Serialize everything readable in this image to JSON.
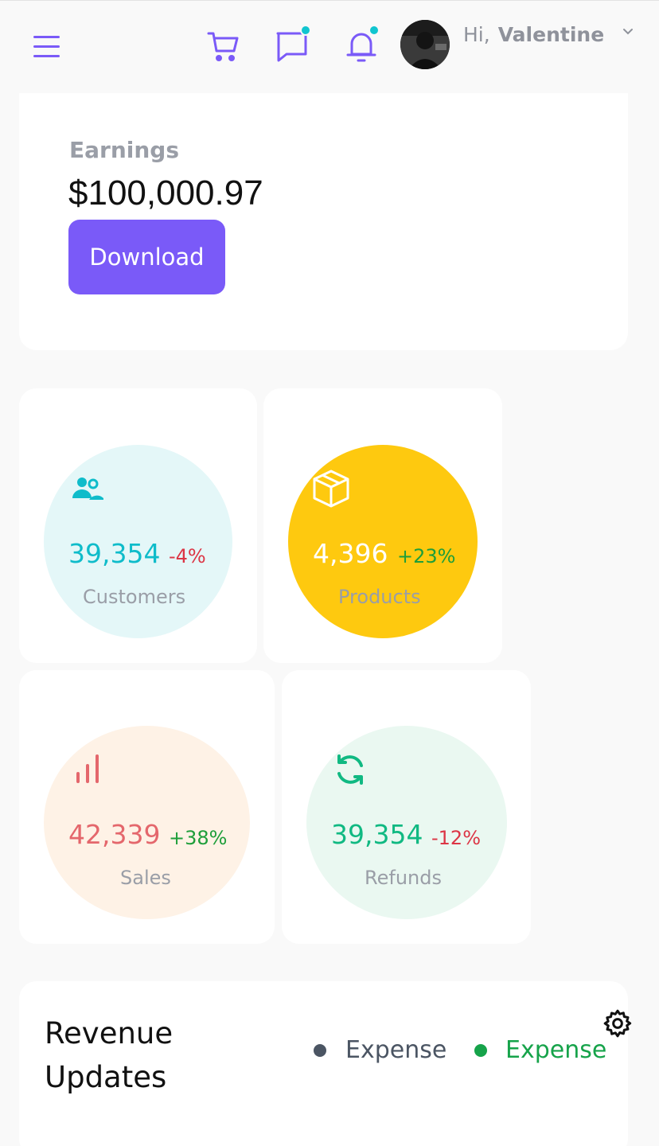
{
  "header": {
    "menu_icon": "hamburger-menu-icon",
    "cart_icon": "cart-icon",
    "messages_icon": "chat-bubble-icon",
    "notifications_icon": "bell-icon",
    "greeting": "Hi,",
    "user_name": "Valentine",
    "dropdown_icon": "chevron-down-icon"
  },
  "earnings": {
    "label": "Earnings",
    "value": "$100,000.97",
    "button_label": "Download"
  },
  "stats": [
    {
      "icon": "users-icon",
      "value": "39,354",
      "change": "-4%",
      "label": "Customers",
      "color": "#0fbcca",
      "bg": "#e4f7f8",
      "change_color": "#dc3545"
    },
    {
      "icon": "box-icon",
      "value": "4,396",
      "change": "+23%",
      "label": "Products",
      "color": "#ffffff",
      "bg": "#fec90f",
      "change_color": "#1e9e3a"
    },
    {
      "icon": "bar-chart-icon",
      "value": "42,339",
      "change": "+38%",
      "label": "Sales",
      "color": "#e4676c",
      "bg": "#fef2e6",
      "change_color": "#1e9e3a"
    },
    {
      "icon": "refresh-icon",
      "value": "39,354",
      "change": "-12%",
      "label": "Refunds",
      "color": "#10b982",
      "bg": "#eaf8f1",
      "change_color": "#dc3545"
    }
  ],
  "revenue": {
    "title": "Revenue Updates",
    "legend": [
      {
        "label": "Expense",
        "color": "#4b5563"
      },
      {
        "label": "Expense",
        "color": "#16a34a"
      }
    ],
    "settings_icon": "gear-icon"
  },
  "colors": {
    "accent": "#7a5af8",
    "badge": "#11c5d0"
  }
}
